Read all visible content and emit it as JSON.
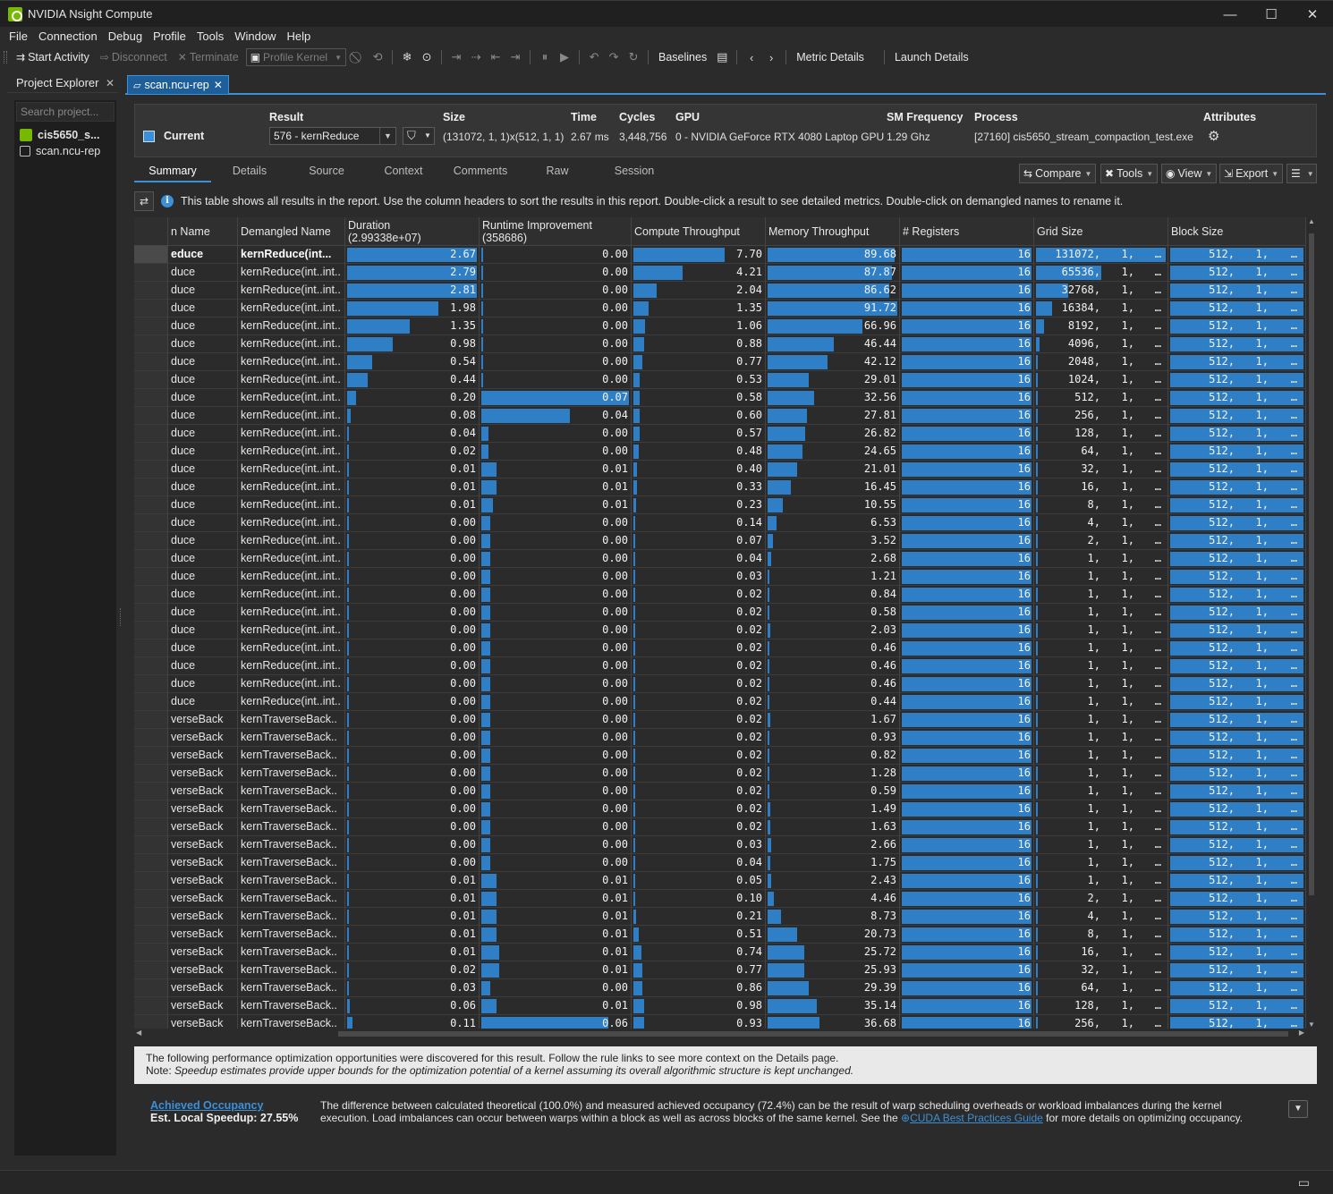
{
  "window": {
    "title": "NVIDIA Nsight Compute",
    "minimize": "—",
    "maximize": "☐",
    "close": "✕"
  },
  "menu": [
    "File",
    "Connection",
    "Debug",
    "Profile",
    "Tools",
    "Window",
    "Help"
  ],
  "toolbar": {
    "start_activity": "Start Activity",
    "disconnect": "Disconnect",
    "terminate": "Terminate",
    "profile_kernel": "Profile Kernel",
    "baselines": "Baselines",
    "metric_details": "Metric Details",
    "launch_details": "Launch Details"
  },
  "project_explorer": {
    "title": "Project Explorer",
    "search_placeholder": "Search project...",
    "project_name": "cis5650_s...",
    "file_name": "scan.ncu-rep"
  },
  "doc_tab": {
    "label": "scan.ncu-rep"
  },
  "result_header": {
    "current_label": "Current",
    "result_label": "Result",
    "result_value": "576 - kernReduce",
    "size_label": "Size",
    "size_value": "(131072, 1, 1)x(512, 1, 1)",
    "time_label": "Time",
    "time_value": "2.67 ms",
    "cycles_label": "Cycles",
    "cycles_value": "3,448,756",
    "gpu_label": "GPU",
    "gpu_value": "0 - NVIDIA GeForce RTX 4080 Laptop GPU",
    "sm_label": "SM Frequency",
    "sm_value": "1.29 Ghz",
    "process_label": "Process",
    "process_value": "[27160] cis5650_stream_compaction_test.exe",
    "attributes_label": "Attributes",
    "current_color": "#3a8fd9"
  },
  "report_tabs": [
    "Summary",
    "Details",
    "Source",
    "Context",
    "Comments",
    "Raw",
    "Session"
  ],
  "report_buttons": {
    "compare": "Compare",
    "tools": "Tools",
    "view": "View",
    "export": "Export"
  },
  "info_text": "This table shows all results in the report. Use the column headers to sort the results in this report. Double-click a result to see detailed metrics. Double-click on demangled names to rename it.",
  "table": {
    "headers": {
      "func": "n Name",
      "demangled": "Demangled Name",
      "duration": "Duration",
      "duration_sub": "(2.99338e+07)",
      "runtime": "Runtime Improvement",
      "runtime_sub": "(358686)",
      "compute": "Compute Throughput",
      "memory": "Memory Throughput",
      "registers": "# Registers",
      "grid": "Grid Size",
      "block": "Block Size"
    },
    "rows": [
      {
        "func": "educe",
        "dem": "kernReduce(int...",
        "dur": "2.67",
        "rt": "0.00",
        "ct": "7.70",
        "mt": "89.68",
        "reg": "16",
        "g": "131072,",
        "dur_f": 1.0,
        "rt_f": 0.0,
        "ct_f": 0.7,
        "mt_f": 0.98,
        "g_f": 1.0
      },
      {
        "func": "duce",
        "dem": "kernReduce(int..int..",
        "dur": "2.79",
        "rt": "0.00",
        "ct": "4.21",
        "mt": "87.87",
        "reg": "16",
        "g": "65536,",
        "dur_f": 1.0,
        "rt_f": 0.0,
        "ct_f": 0.38,
        "mt_f": 0.96,
        "g_f": 0.5
      },
      {
        "func": "duce",
        "dem": "kernReduce(int..int..",
        "dur": "2.81",
        "rt": "0.00",
        "ct": "2.04",
        "mt": "86.62",
        "reg": "16",
        "g": "32768,",
        "dur_f": 1.0,
        "rt_f": 0.0,
        "ct_f": 0.18,
        "mt_f": 0.94,
        "g_f": 0.25
      },
      {
        "func": "duce",
        "dem": "kernReduce(int..int..",
        "dur": "1.98",
        "rt": "0.00",
        "ct": "1.35",
        "mt": "91.72",
        "reg": "16",
        "g": "16384,",
        "dur_f": 0.7,
        "rt_f": 0.0,
        "ct_f": 0.12,
        "mt_f": 1.0,
        "g_f": 0.125
      },
      {
        "func": "duce",
        "dem": "kernReduce(int..int..",
        "dur": "1.35",
        "rt": "0.00",
        "ct": "1.06",
        "mt": "66.96",
        "reg": "16",
        "g": "8192,",
        "dur_f": 0.48,
        "rt_f": 0.0,
        "ct_f": 0.09,
        "mt_f": 0.73,
        "g_f": 0.062
      },
      {
        "func": "duce",
        "dem": "kernReduce(int..int..",
        "dur": "0.98",
        "rt": "0.00",
        "ct": "0.88",
        "mt": "46.44",
        "reg": "16",
        "g": "4096,",
        "dur_f": 0.35,
        "rt_f": 0.0,
        "ct_f": 0.08,
        "mt_f": 0.51,
        "g_f": 0.031
      },
      {
        "func": "duce",
        "dem": "kernReduce(int..int..",
        "dur": "0.54",
        "rt": "0.00",
        "ct": "0.77",
        "mt": "42.12",
        "reg": "16",
        "g": "2048,",
        "dur_f": 0.19,
        "rt_f": 0.0,
        "ct_f": 0.07,
        "mt_f": 0.46,
        "g_f": 0.016
      },
      {
        "func": "duce",
        "dem": "kernReduce(int..int..",
        "dur": "0.44",
        "rt": "0.00",
        "ct": "0.53",
        "mt": "29.01",
        "reg": "16",
        "g": "1024,",
        "dur_f": 0.16,
        "rt_f": 0.0,
        "ct_f": 0.05,
        "mt_f": 0.32,
        "g_f": 0.008
      },
      {
        "func": "duce",
        "dem": "kernReduce(int..int..",
        "dur": "0.20",
        "rt": "0.07",
        "ct": "0.58",
        "mt": "32.56",
        "reg": "16",
        "g": "512,",
        "dur_f": 0.07,
        "rt_f": 1.0,
        "ct_f": 0.05,
        "mt_f": 0.36,
        "g_f": 0.004
      },
      {
        "func": "duce",
        "dem": "kernReduce(int..int..",
        "dur": "0.08",
        "rt": "0.04",
        "ct": "0.60",
        "mt": "27.81",
        "reg": "16",
        "g": "256,",
        "dur_f": 0.03,
        "rt_f": 0.6,
        "ct_f": 0.05,
        "mt_f": 0.3,
        "g_f": 0.002
      },
      {
        "func": "duce",
        "dem": "kernReduce(int..int..",
        "dur": "0.04",
        "rt": "0.00",
        "ct": "0.57",
        "mt": "26.82",
        "reg": "16",
        "g": "128,",
        "dur_f": 0.015,
        "rt_f": 0.05,
        "ct_f": 0.05,
        "mt_f": 0.29,
        "g_f": 0.001
      },
      {
        "func": "duce",
        "dem": "kernReduce(int..int..",
        "dur": "0.02",
        "rt": "0.00",
        "ct": "0.48",
        "mt": "24.65",
        "reg": "16",
        "g": "64,",
        "dur_f": 0.008,
        "rt_f": 0.05,
        "ct_f": 0.04,
        "mt_f": 0.27,
        "g_f": 0.0
      },
      {
        "func": "duce",
        "dem": "kernReduce(int..int..",
        "dur": "0.01",
        "rt": "0.01",
        "ct": "0.40",
        "mt": "21.01",
        "reg": "16",
        "g": "32,",
        "dur_f": 0.004,
        "rt_f": 0.1,
        "ct_f": 0.03,
        "mt_f": 0.23,
        "g_f": 0.0
      },
      {
        "func": "duce",
        "dem": "kernReduce(int..int..",
        "dur": "0.01",
        "rt": "0.01",
        "ct": "0.33",
        "mt": "16.45",
        "reg": "16",
        "g": "16,",
        "dur_f": 0.004,
        "rt_f": 0.1,
        "ct_f": 0.03,
        "mt_f": 0.18,
        "g_f": 0.0
      },
      {
        "func": "duce",
        "dem": "kernReduce(int..int..",
        "dur": "0.01",
        "rt": "0.01",
        "ct": "0.23",
        "mt": "10.55",
        "reg": "16",
        "g": "8,",
        "dur_f": 0.004,
        "rt_f": 0.08,
        "ct_f": 0.02,
        "mt_f": 0.12,
        "g_f": 0.0
      },
      {
        "func": "duce",
        "dem": "kernReduce(int..int..",
        "dur": "0.00",
        "rt": "0.00",
        "ct": "0.14",
        "mt": "6.53",
        "reg": "16",
        "g": "4,",
        "dur_f": 0.0,
        "rt_f": 0.06,
        "ct_f": 0.01,
        "mt_f": 0.07,
        "g_f": 0.0
      },
      {
        "func": "duce",
        "dem": "kernReduce(int..int..",
        "dur": "0.00",
        "rt": "0.00",
        "ct": "0.07",
        "mt": "3.52",
        "reg": "16",
        "g": "2,",
        "dur_f": 0.0,
        "rt_f": 0.06,
        "ct_f": 0.01,
        "mt_f": 0.04,
        "g_f": 0.0
      },
      {
        "func": "duce",
        "dem": "kernReduce(int..int..",
        "dur": "0.00",
        "rt": "0.00",
        "ct": "0.04",
        "mt": "2.68",
        "reg": "16",
        "g": "1,",
        "dur_f": 0.0,
        "rt_f": 0.06,
        "ct_f": 0.0,
        "mt_f": 0.03,
        "g_f": 0.0
      },
      {
        "func": "duce",
        "dem": "kernReduce(int..int..",
        "dur": "0.00",
        "rt": "0.00",
        "ct": "0.03",
        "mt": "1.21",
        "reg": "16",
        "g": "1,",
        "dur_f": 0.0,
        "rt_f": 0.06,
        "ct_f": 0.0,
        "mt_f": 0.01,
        "g_f": 0.0
      },
      {
        "func": "duce",
        "dem": "kernReduce(int..int..",
        "dur": "0.00",
        "rt": "0.00",
        "ct": "0.02",
        "mt": "0.84",
        "reg": "16",
        "g": "1,",
        "dur_f": 0.0,
        "rt_f": 0.06,
        "ct_f": 0.0,
        "mt_f": 0.01,
        "g_f": 0.0
      },
      {
        "func": "duce",
        "dem": "kernReduce(int..int..",
        "dur": "0.00",
        "rt": "0.00",
        "ct": "0.02",
        "mt": "0.58",
        "reg": "16",
        "g": "1,",
        "dur_f": 0.0,
        "rt_f": 0.06,
        "ct_f": 0.0,
        "mt_f": 0.01,
        "g_f": 0.0
      },
      {
        "func": "duce",
        "dem": "kernReduce(int..int..",
        "dur": "0.00",
        "rt": "0.00",
        "ct": "0.02",
        "mt": "2.03",
        "reg": "16",
        "g": "1,",
        "dur_f": 0.0,
        "rt_f": 0.06,
        "ct_f": 0.0,
        "mt_f": 0.02,
        "g_f": 0.0
      },
      {
        "func": "duce",
        "dem": "kernReduce(int..int..",
        "dur": "0.00",
        "rt": "0.00",
        "ct": "0.02",
        "mt": "0.46",
        "reg": "16",
        "g": "1,",
        "dur_f": 0.0,
        "rt_f": 0.06,
        "ct_f": 0.0,
        "mt_f": 0.01,
        "g_f": 0.0
      },
      {
        "func": "duce",
        "dem": "kernReduce(int..int..",
        "dur": "0.00",
        "rt": "0.00",
        "ct": "0.02",
        "mt": "0.46",
        "reg": "16",
        "g": "1,",
        "dur_f": 0.0,
        "rt_f": 0.06,
        "ct_f": 0.0,
        "mt_f": 0.01,
        "g_f": 0.0
      },
      {
        "func": "duce",
        "dem": "kernReduce(int..int..",
        "dur": "0.00",
        "rt": "0.00",
        "ct": "0.02",
        "mt": "0.46",
        "reg": "16",
        "g": "1,",
        "dur_f": 0.0,
        "rt_f": 0.06,
        "ct_f": 0.0,
        "mt_f": 0.01,
        "g_f": 0.0
      },
      {
        "func": "duce",
        "dem": "kernReduce(int..int..",
        "dur": "0.00",
        "rt": "0.00",
        "ct": "0.02",
        "mt": "0.44",
        "reg": "16",
        "g": "1,",
        "dur_f": 0.0,
        "rt_f": 0.06,
        "ct_f": 0.0,
        "mt_f": 0.01,
        "g_f": 0.0
      },
      {
        "func": "verseBack",
        "dem": "kernTraverseBack..",
        "dur": "0.00",
        "rt": "0.00",
        "ct": "0.02",
        "mt": "1.67",
        "reg": "16",
        "g": "1,",
        "dur_f": 0.0,
        "rt_f": 0.06,
        "ct_f": 0.0,
        "mt_f": 0.02,
        "g_f": 0.0
      },
      {
        "func": "verseBack",
        "dem": "kernTraverseBack..",
        "dur": "0.00",
        "rt": "0.00",
        "ct": "0.02",
        "mt": "0.93",
        "reg": "16",
        "g": "1,",
        "dur_f": 0.0,
        "rt_f": 0.06,
        "ct_f": 0.0,
        "mt_f": 0.01,
        "g_f": 0.0
      },
      {
        "func": "verseBack",
        "dem": "kernTraverseBack..",
        "dur": "0.00",
        "rt": "0.00",
        "ct": "0.02",
        "mt": "0.82",
        "reg": "16",
        "g": "1,",
        "dur_f": 0.0,
        "rt_f": 0.06,
        "ct_f": 0.0,
        "mt_f": 0.01,
        "g_f": 0.0
      },
      {
        "func": "verseBack",
        "dem": "kernTraverseBack..",
        "dur": "0.00",
        "rt": "0.00",
        "ct": "0.02",
        "mt": "1.28",
        "reg": "16",
        "g": "1,",
        "dur_f": 0.0,
        "rt_f": 0.06,
        "ct_f": 0.0,
        "mt_f": 0.01,
        "g_f": 0.0
      },
      {
        "func": "verseBack",
        "dem": "kernTraverseBack..",
        "dur": "0.00",
        "rt": "0.00",
        "ct": "0.02",
        "mt": "0.59",
        "reg": "16",
        "g": "1,",
        "dur_f": 0.0,
        "rt_f": 0.06,
        "ct_f": 0.0,
        "mt_f": 0.01,
        "g_f": 0.0
      },
      {
        "func": "verseBack",
        "dem": "kernTraverseBack..",
        "dur": "0.00",
        "rt": "0.00",
        "ct": "0.02",
        "mt": "1.49",
        "reg": "16",
        "g": "1,",
        "dur_f": 0.0,
        "rt_f": 0.06,
        "ct_f": 0.0,
        "mt_f": 0.02,
        "g_f": 0.0
      },
      {
        "func": "verseBack",
        "dem": "kernTraverseBack..",
        "dur": "0.00",
        "rt": "0.00",
        "ct": "0.02",
        "mt": "1.63",
        "reg": "16",
        "g": "1,",
        "dur_f": 0.0,
        "rt_f": 0.06,
        "ct_f": 0.0,
        "mt_f": 0.02,
        "g_f": 0.0
      },
      {
        "func": "verseBack",
        "dem": "kernTraverseBack..",
        "dur": "0.00",
        "rt": "0.00",
        "ct": "0.03",
        "mt": "2.66",
        "reg": "16",
        "g": "1,",
        "dur_f": 0.0,
        "rt_f": 0.06,
        "ct_f": 0.0,
        "mt_f": 0.03,
        "g_f": 0.0
      },
      {
        "func": "verseBack",
        "dem": "kernTraverseBack..",
        "dur": "0.00",
        "rt": "0.00",
        "ct": "0.04",
        "mt": "1.75",
        "reg": "16",
        "g": "1,",
        "dur_f": 0.0,
        "rt_f": 0.06,
        "ct_f": 0.0,
        "mt_f": 0.02,
        "g_f": 0.0
      },
      {
        "func": "verseBack",
        "dem": "kernTraverseBack..",
        "dur": "0.01",
        "rt": "0.01",
        "ct": "0.05",
        "mt": "2.43",
        "reg": "16",
        "g": "1,",
        "dur_f": 0.004,
        "rt_f": 0.1,
        "ct_f": 0.0,
        "mt_f": 0.03,
        "g_f": 0.0
      },
      {
        "func": "verseBack",
        "dem": "kernTraverseBack..",
        "dur": "0.01",
        "rt": "0.01",
        "ct": "0.10",
        "mt": "4.46",
        "reg": "16",
        "g": "2,",
        "dur_f": 0.004,
        "rt_f": 0.1,
        "ct_f": 0.01,
        "mt_f": 0.05,
        "g_f": 0.0
      },
      {
        "func": "verseBack",
        "dem": "kernTraverseBack..",
        "dur": "0.01",
        "rt": "0.01",
        "ct": "0.21",
        "mt": "8.73",
        "reg": "16",
        "g": "4,",
        "dur_f": 0.004,
        "rt_f": 0.1,
        "ct_f": 0.02,
        "mt_f": 0.1,
        "g_f": 0.0
      },
      {
        "func": "verseBack",
        "dem": "kernTraverseBack..",
        "dur": "0.01",
        "rt": "0.01",
        "ct": "0.51",
        "mt": "20.73",
        "reg": "16",
        "g": "8,",
        "dur_f": 0.004,
        "rt_f": 0.1,
        "ct_f": 0.04,
        "mt_f": 0.23,
        "g_f": 0.0
      },
      {
        "func": "verseBack",
        "dem": "kernTraverseBack..",
        "dur": "0.01",
        "rt": "0.01",
        "ct": "0.74",
        "mt": "25.72",
        "reg": "16",
        "g": "16,",
        "dur_f": 0.004,
        "rt_f": 0.12,
        "ct_f": 0.06,
        "mt_f": 0.28,
        "g_f": 0.0
      },
      {
        "func": "verseBack",
        "dem": "kernTraverseBack..",
        "dur": "0.02",
        "rt": "0.01",
        "ct": "0.77",
        "mt": "25.93",
        "reg": "16",
        "g": "32,",
        "dur_f": 0.008,
        "rt_f": 0.12,
        "ct_f": 0.07,
        "mt_f": 0.28,
        "g_f": 0.0
      },
      {
        "func": "verseBack",
        "dem": "kernTraverseBack..",
        "dur": "0.03",
        "rt": "0.00",
        "ct": "0.86",
        "mt": "29.39",
        "reg": "16",
        "g": "64,",
        "dur_f": 0.01,
        "rt_f": 0.06,
        "ct_f": 0.07,
        "mt_f": 0.32,
        "g_f": 0.0
      },
      {
        "func": "verseBack",
        "dem": "kernTraverseBack..",
        "dur": "0.06",
        "rt": "0.01",
        "ct": "0.98",
        "mt": "35.14",
        "reg": "16",
        "g": "128,",
        "dur_f": 0.02,
        "rt_f": 0.1,
        "ct_f": 0.08,
        "mt_f": 0.38,
        "g_f": 0.0
      },
      {
        "func": "verseBack",
        "dem": "kernTraverseBack..",
        "dur": "0.11",
        "rt": "0.06",
        "ct": "0.93",
        "mt": "36.68",
        "reg": "16",
        "g": "256,",
        "dur_f": 0.04,
        "rt_f": 0.86,
        "ct_f": 0.08,
        "mt_f": 0.4,
        "g_f": 0.0
      }
    ],
    "grid_yz": "1,",
    "block_x": "512,",
    "block_y": "1,",
    "ellipsis": "…"
  },
  "rules": {
    "line1": "The following performance optimization opportunities were discovered for this result. Follow the rule links to see more context on the Details page.",
    "note_label": "Note: ",
    "note_text": "Speedup estimates provide upper bounds for the optimization potential of a kernel assuming its overall algorithmic structure is kept unchanged."
  },
  "occupancy": {
    "title": "Achieved Occupancy",
    "speedup": "Est. Local Speedup: 27.55%",
    "desc_before": "The difference between calculated theoretical (100.0%) and measured achieved occupancy (72.4%) can be the result of warp scheduling overheads or workload imbalances during the kernel execution. Load imbalances can occur between warps within a block as well as across blocks of the same kernel. See the ",
    "link": "CUDA Best Practices Guide",
    "desc_after": " for more details on optimizing occupancy."
  },
  "colors": {
    "bar": "#2f7fc7",
    "accent": "#3d8fd6",
    "nvidia": "#76b900"
  }
}
